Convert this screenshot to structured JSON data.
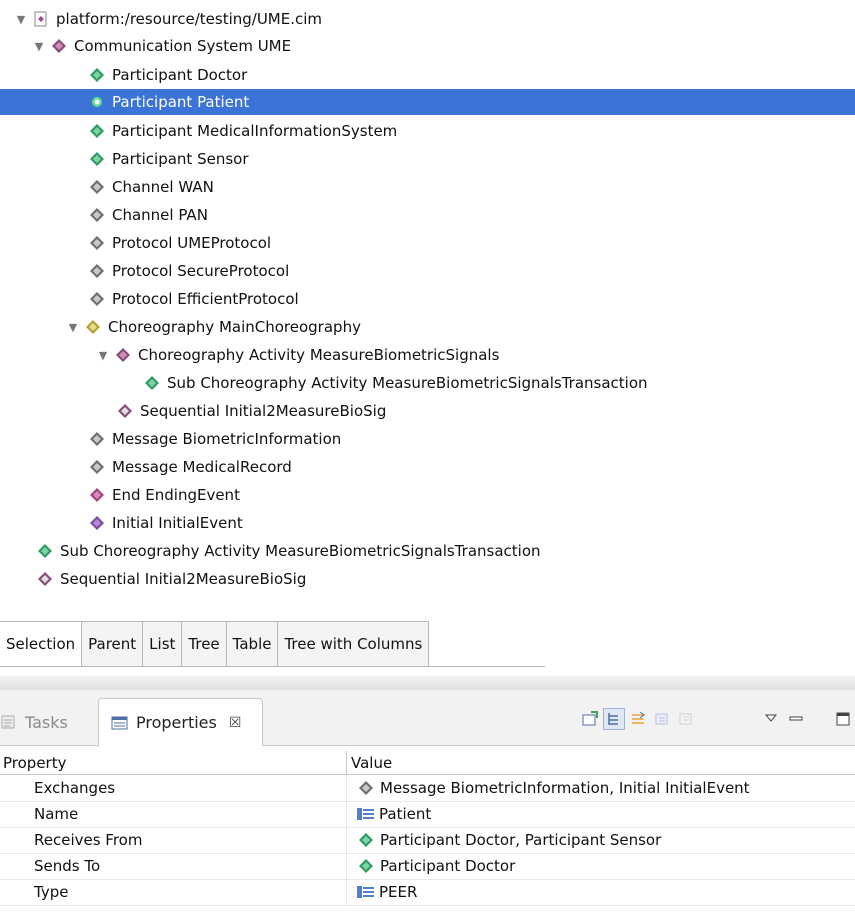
{
  "tree": {
    "root": "platform:/resource/testing/UME.cim",
    "items": [
      {
        "label": "Communication System UME"
      },
      {
        "label": "Participant Doctor"
      },
      {
        "label": "Participant Patient"
      },
      {
        "label": "Participant MedicalInformationSystem"
      },
      {
        "label": "Participant Sensor"
      },
      {
        "label": "Channel WAN"
      },
      {
        "label": "Channel PAN"
      },
      {
        "label": "Protocol UMEProtocol"
      },
      {
        "label": "Protocol SecureProtocol"
      },
      {
        "label": "Protocol EfficientProtocol"
      },
      {
        "label": "Choreography MainChoreography"
      },
      {
        "label": "Choreography Activity MeasureBiometricSignals"
      },
      {
        "label": "Sub Choreography Activity MeasureBiometricSignalsTransaction"
      },
      {
        "label": "Sequential Initial2MeasureBioSig"
      },
      {
        "label": "Message BiometricInformation"
      },
      {
        "label": "Message MedicalRecord"
      },
      {
        "label": "End EndingEvent"
      },
      {
        "label": "Initial InitialEvent"
      },
      {
        "label": "Sub Choreography Activity MeasureBiometricSignalsTransaction"
      },
      {
        "label": "Sequential Initial2MeasureBioSig"
      }
    ]
  },
  "tabs": [
    "Selection",
    "Parent",
    "List",
    "Tree",
    "Table",
    "Tree with Columns"
  ],
  "view": {
    "tasks_label": "Tasks",
    "properties_label": "Properties",
    "close_glyph": "☒"
  },
  "properties": {
    "header_property": "Property",
    "header_value": "Value",
    "rows": [
      {
        "property": "Exchanges",
        "value": "Message BiometricInformation, Initial InitialEvent",
        "icon": "grey-diamond-icon"
      },
      {
        "property": "Name",
        "value": "Patient",
        "icon": "text-field-icon"
      },
      {
        "property": "Receives From",
        "value": "Participant Doctor, Participant Sensor",
        "icon": "green-diamond-icon"
      },
      {
        "property": "Sends To",
        "value": "Participant Doctor",
        "icon": "green-diamond-icon"
      },
      {
        "property": "Type",
        "value": "PEER",
        "icon": "text-field-icon"
      }
    ]
  },
  "colors": {
    "selection": "#3c73d6",
    "green": "#2f9a62",
    "grey": "#7a7a7a",
    "purple": "#8a4a7a",
    "olive": "#b2a22c",
    "violet": "#7a4aa0"
  }
}
